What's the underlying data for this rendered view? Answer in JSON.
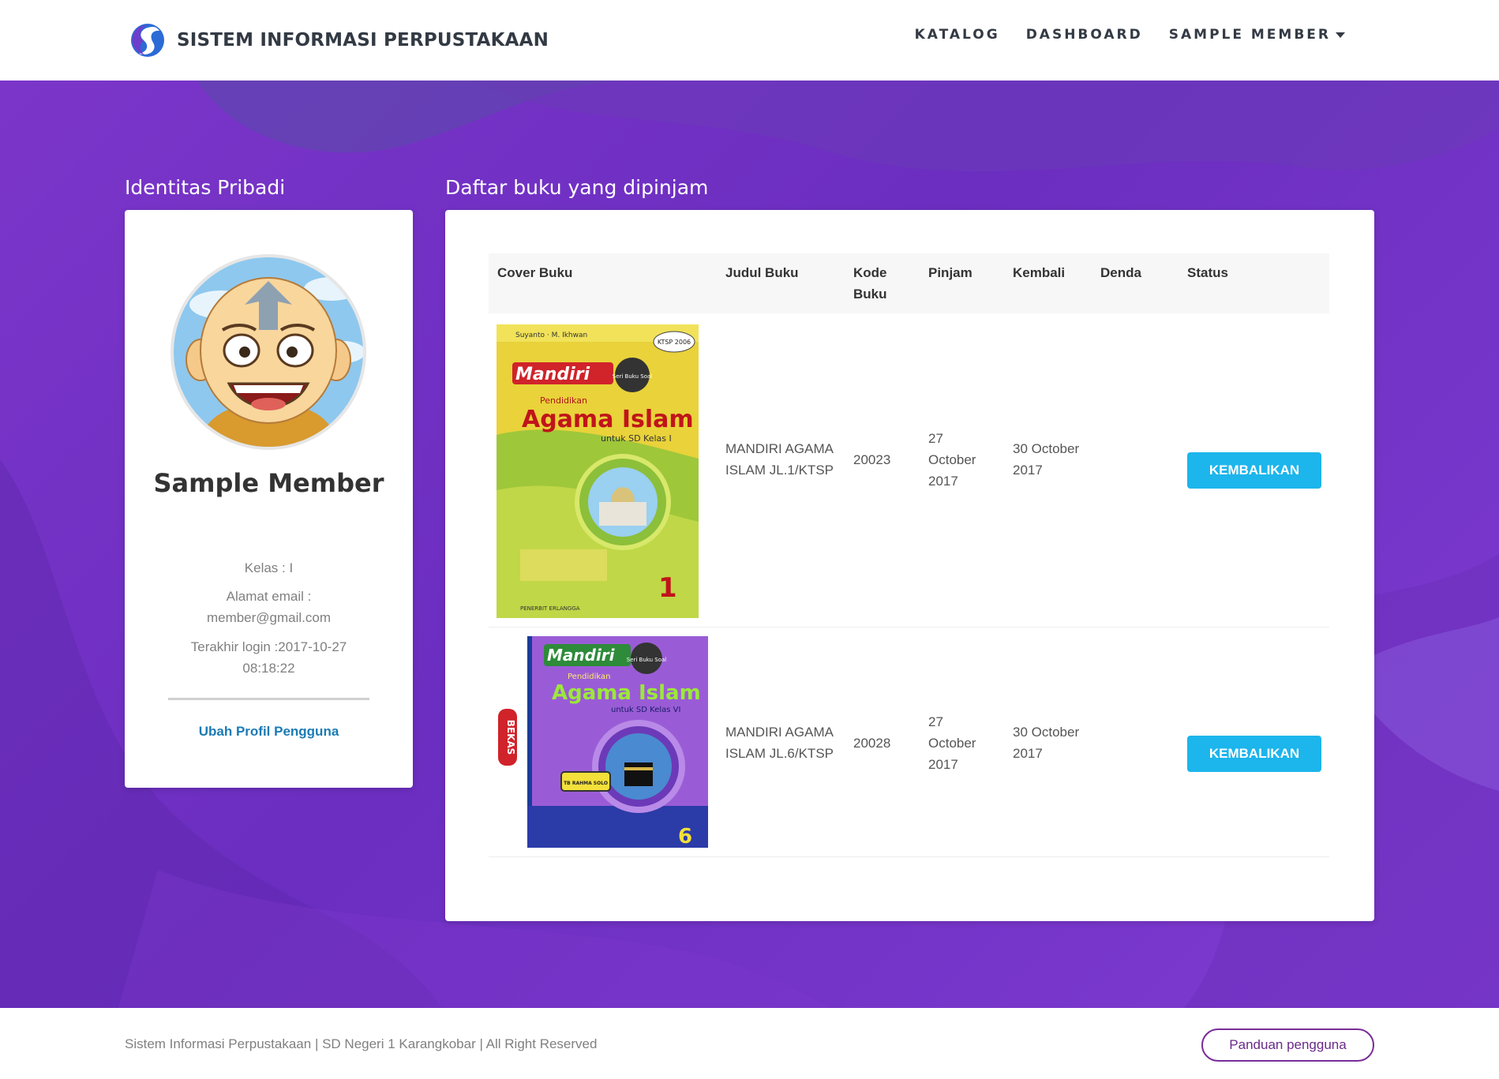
{
  "header": {
    "brand_name": "SISTEM INFORMASI PERPUSTAKAAN",
    "logo_icon": "library-s-logo-icon",
    "nav": [
      {
        "label": "KATALOG"
      },
      {
        "label": "DASHBOARD"
      },
      {
        "label": "SAMPLE MEMBER",
        "dropdown": true
      }
    ]
  },
  "profile": {
    "section_title": "Identitas Pribadi",
    "avatar_icon": "member-avatar",
    "name": "Sample Member",
    "kelas": "Kelas : I",
    "email_label": "Alamat email :",
    "email": "member@gmail.com",
    "last_login_label": "Terakhir login :2017-10-27",
    "last_login_time": "08:18:22",
    "edit_link": "Ubah Profil Pengguna"
  },
  "books": {
    "section_title": "Daftar buku yang dipinjam",
    "columns": [
      "Cover Buku",
      "Judul Buku",
      "Kode Buku",
      "Pinjam",
      "Kembali",
      "Denda",
      "Status"
    ],
    "rows": [
      {
        "cover": {
          "author": "Suyanto · M. Ikhwan",
          "brand": "Mandiri",
          "subject": "Pendidikan",
          "title": "Agama Islam",
          "grade": "untuk SD Kelas I",
          "number": "1",
          "badge": "KTSP 2006",
          "series": "Seri Buku Soal",
          "publisher": "PENERBIT ERLANGGA"
        },
        "judul": "MANDIRI AGAMA ISLAM JL.1/KTSP",
        "kode": "20023",
        "pinjam": "27 October 2017",
        "kembali": "30 October 2017",
        "denda": "",
        "action": "KEMBALIKAN"
      },
      {
        "cover": {
          "brand": "Mandiri",
          "subject": "Pendidikan",
          "title": "Agama Islam",
          "grade": "untuk SD Kelas VI",
          "number": "6",
          "series": "Seri Buku Soal",
          "stamp": "BEKAS",
          "sticker": "TB RAHMA SOLO"
        },
        "judul": "MANDIRI AGAMA ISLAM JL.6/KTSP",
        "kode": "20028",
        "pinjam": "27 October 2017",
        "kembali": "30 October 2017",
        "denda": "",
        "action": "KEMBALIKAN"
      }
    ]
  },
  "footer": {
    "text": "Sistem Informasi Perpustakaan | SD Negeri 1 Karangkobar | All Right Reserved",
    "guide_button": "Panduan pengguna"
  },
  "colors": {
    "hero_purple": "#7b35c9",
    "button_blue": "#1cb5ec",
    "link_blue": "#1a7bb5",
    "guide_border": "#7a2c97"
  }
}
